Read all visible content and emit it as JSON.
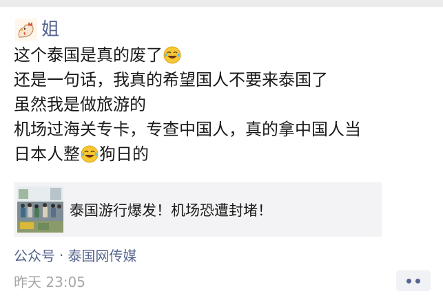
{
  "post": {
    "author": "姐",
    "author_avatar_icon": "rooster-icon",
    "lines": [
      {
        "parts": [
          {
            "type": "text",
            "value": "这个泰国是真的废了"
          },
          {
            "type": "emoji",
            "name": "laugh-cry-emoji"
          }
        ]
      },
      {
        "parts": [
          {
            "type": "text",
            "value": "还是一句话，我真的希望国人不要来泰国了"
          }
        ]
      },
      {
        "parts": [
          {
            "type": "text",
            "value": "虽然我是做旅游的"
          }
        ]
      },
      {
        "parts": [
          {
            "type": "text",
            "value": "机场过海关专卡，专查中国人，真的拿中国人当"
          }
        ]
      },
      {
        "parts": [
          {
            "type": "text",
            "value": "日本人整"
          },
          {
            "type": "emoji",
            "name": "laugh-cry-emoji"
          },
          {
            "type": "text",
            "value": "狗日的"
          }
        ]
      }
    ],
    "shared_link": {
      "title": "泰国游行爆发！机场恐遭封堵！",
      "thumbnail_icon": "news-photo-thumbnail"
    },
    "source": {
      "label": "公众号",
      "separator": "·",
      "name": "泰国网传媒"
    },
    "time": "昨天 23:05",
    "more_button_icon": "more-dots-icon"
  },
  "colors": {
    "link_blue": "#56648f",
    "time_gray": "#a5a5a5",
    "card_bg": "#f3f3f5"
  }
}
